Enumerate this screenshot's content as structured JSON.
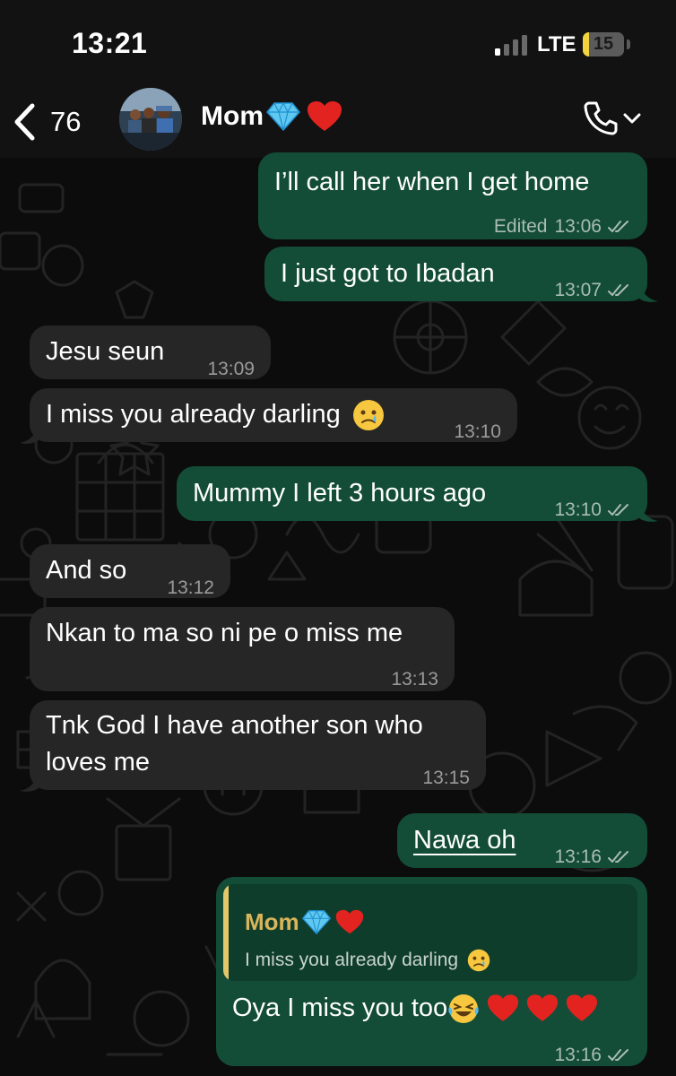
{
  "status_bar": {
    "time": "13:21",
    "network": "LTE",
    "battery": "15"
  },
  "header": {
    "back_count": "76",
    "contact_name": "Mom"
  },
  "colors": {
    "outgoing": "#134d37",
    "incoming": "#262626",
    "quote_name": "#d8b45a"
  },
  "messages": [
    {
      "direction": "out",
      "text": "I’ll call her when I get home",
      "edited": "Edited",
      "time": "13:06",
      "status": "read"
    },
    {
      "direction": "out",
      "text": "I just got to Ibadan",
      "time": "13:07",
      "status": "read"
    },
    {
      "direction": "in",
      "text": "Jesu seun",
      "time": "13:09"
    },
    {
      "direction": "in",
      "text": "I miss you already darling",
      "emoji": "crying-face",
      "time": "13:10"
    },
    {
      "direction": "out",
      "text": "Mummy I left 3 hours ago",
      "time": "13:10",
      "status": "read"
    },
    {
      "direction": "in",
      "text": "And so",
      "time": "13:12"
    },
    {
      "direction": "in",
      "text": "Nkan to ma so ni pe o miss me",
      "time": "13:13"
    },
    {
      "direction": "in",
      "lines": [
        "Tnk God I have another son who",
        "loves me"
      ],
      "time": "13:15"
    },
    {
      "direction": "out",
      "text": "Nawa oh",
      "time": "13:16",
      "status": "read"
    },
    {
      "direction": "out",
      "quote": {
        "author": "Mom",
        "text": "I miss you already darling"
      },
      "text": "Oya I miss you too",
      "time": "13:16",
      "status": "read"
    }
  ]
}
